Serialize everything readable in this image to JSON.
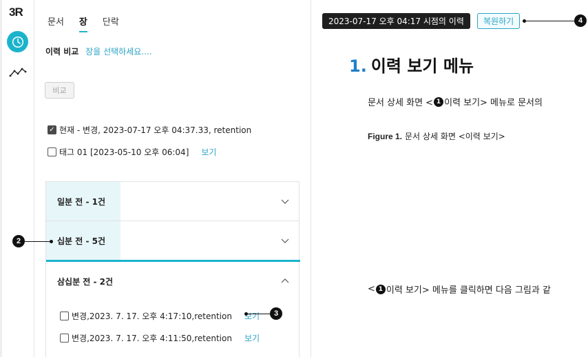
{
  "logo": "3R",
  "rail": {
    "clock_icon": "clock-icon",
    "trend_icon": "trend-icon"
  },
  "tabs": [
    {
      "label": "문서",
      "active": false
    },
    {
      "label": "장",
      "active": true
    },
    {
      "label": "단락",
      "active": false
    }
  ],
  "compare": {
    "label": "이력 비교",
    "placeholder_link": "장을 선택하세요....",
    "button": "비교"
  },
  "selections": [
    {
      "checked": true,
      "text": "현재 - 변경, 2023-07-17 오후 04:37.33, retention",
      "link": ""
    },
    {
      "checked": false,
      "text": "태그 01 [2023-05-10 오후 06:04]",
      "link": "보기"
    }
  ],
  "accordion": [
    {
      "label": "일분 전 - 1건",
      "expanded": false,
      "highlighted": true
    },
    {
      "label": "십분 전 - 5건",
      "expanded": false,
      "highlighted": true
    },
    {
      "label": "삼십분 전 - 2건",
      "expanded": true,
      "highlighted": false,
      "items": [
        {
          "text": "변경,2023. 7. 17. 오후 4:17:10,retention",
          "link": "보기"
        },
        {
          "text": "변경,2023. 7. 17. 오후 4:11:50,retention",
          "link": "보기"
        }
      ]
    }
  ],
  "content": {
    "history_badge": "2023-07-17 오후 04:17 시점의 이력",
    "restore_button": "복원하기",
    "heading_num": "1.",
    "heading_text": "이력 보기 메뉴",
    "para1_pre": "문서 상세 화면 <",
    "para1_badge": "1",
    "para1_post": "이력 보기> 메뉴로 문서의",
    "figure_label": "Figure 1.",
    "figure_caption": "문서 상세 화면 <이력 보기>",
    "para2_pre": "<",
    "para2_badge": "1",
    "para2_post": "이력 보기> 메뉴를 클릭하면 다음 그림과 같"
  },
  "callouts": {
    "c1": "2",
    "c2": "3",
    "c3": "4"
  },
  "colors": {
    "accent": "#1bb3cc",
    "link": "#2aa4c6",
    "heading_num": "#1e7fc8",
    "highlight_bg": "#e7f6f9"
  }
}
